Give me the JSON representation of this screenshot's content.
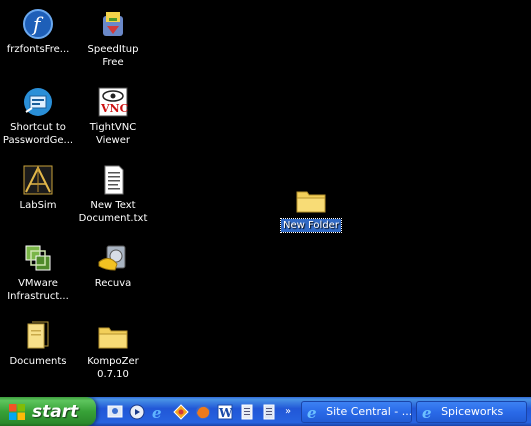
{
  "desktop": {
    "icons": [
      {
        "label": "frzfontsFre...",
        "icon": "firefox-like-f-icon"
      },
      {
        "label": "SpeedItup\nFree",
        "icon": "speeditup-icon"
      },
      {
        "label": "Shortcut to\nPasswordGe...",
        "icon": "password-generator-icon"
      },
      {
        "label": "TightVNC\nViewer",
        "icon": "vnc-icon"
      },
      {
        "label": "LabSim",
        "icon": "labsim-icon"
      },
      {
        "label": "New Text\nDocument.txt",
        "icon": "text-document-icon"
      },
      {
        "label": "VMware\nInfrastruct...",
        "icon": "vmware-icon"
      },
      {
        "label": "Recuva",
        "icon": "recuva-icon"
      },
      {
        "label": "Documents",
        "icon": "documents-icon"
      },
      {
        "label": "KompoZer\n0.7.10",
        "icon": "folder-icon"
      },
      {
        "label": "New Folder",
        "icon": "folder-icon",
        "selected": true
      }
    ]
  },
  "taskbar": {
    "start_label": "start",
    "quicklaunch": [
      "desktop-icon",
      "media-icon",
      "ie-icon",
      "app-icon",
      "firefox-icon",
      "word-icon",
      "doc-icon",
      "doc2-icon"
    ],
    "more_label": "»",
    "tasks": [
      {
        "label": "Site Central - ...",
        "icon": "ie-icon"
      },
      {
        "label": "Spiceworks",
        "icon": "ie-icon"
      }
    ]
  },
  "colors": {
    "taskbar": "#2157d7",
    "start": "#37a137",
    "selection": "#316ac5"
  }
}
